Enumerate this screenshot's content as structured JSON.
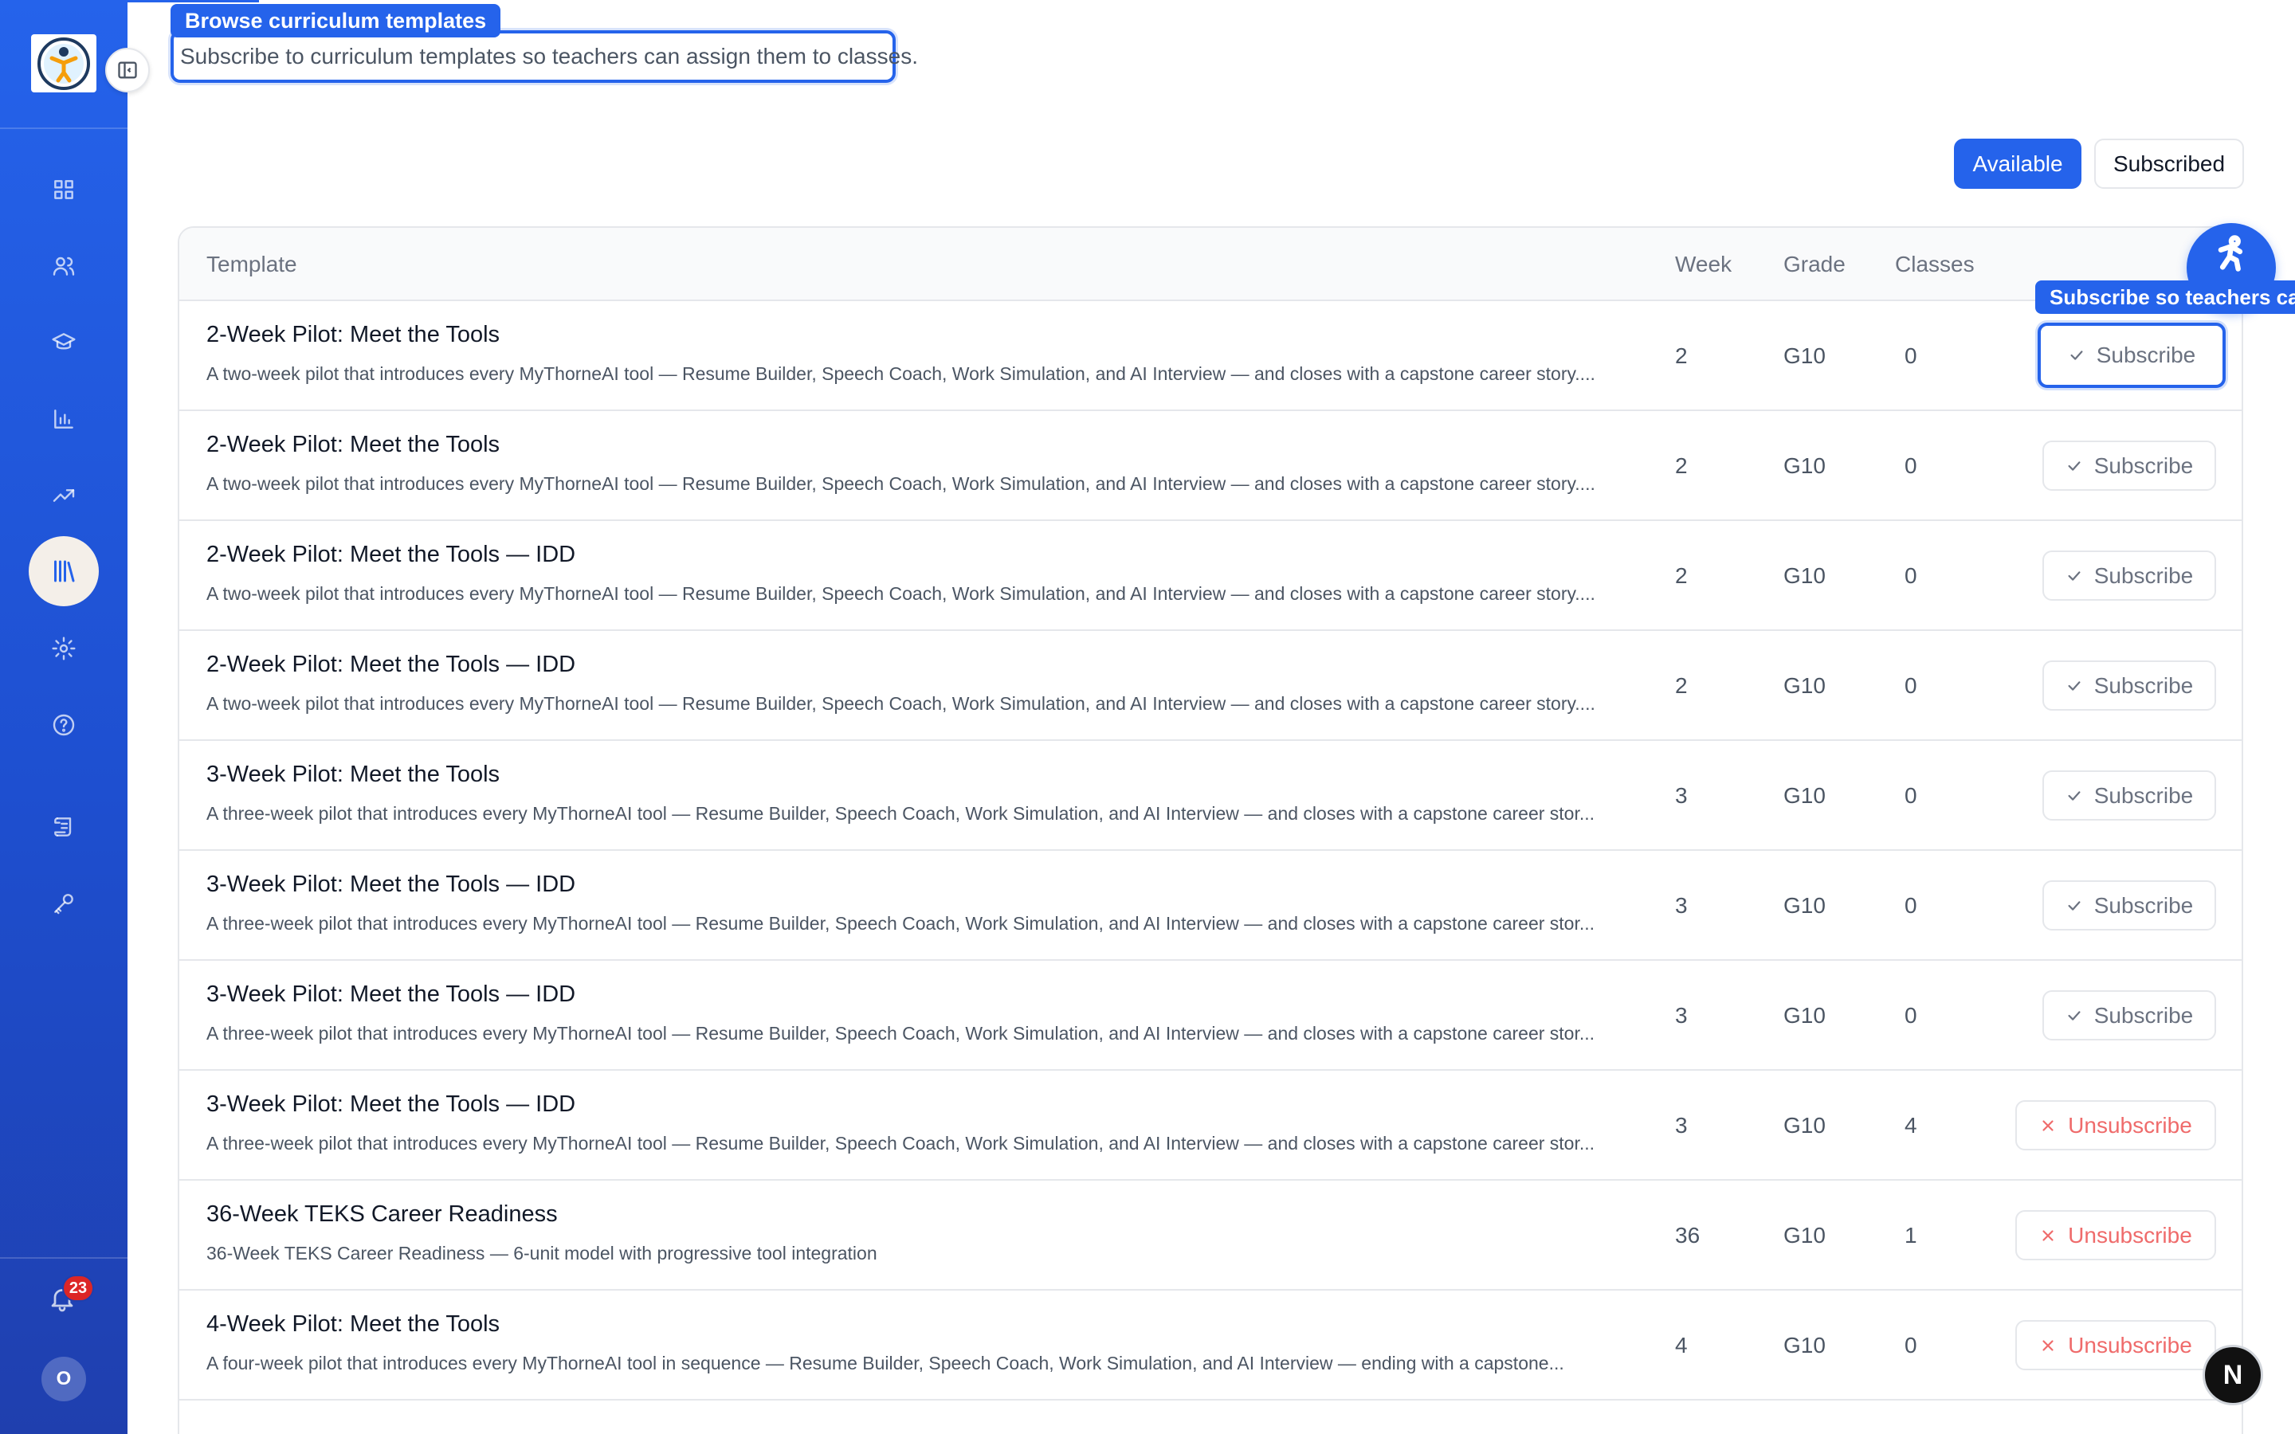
{
  "header": {
    "tour_badge": "Browse curriculum templates",
    "subtitle": "Subscribe to curriculum templates so teachers can assign them to classes."
  },
  "toggle": {
    "available_label": "Available",
    "subscribed_label": "Subscribed"
  },
  "table": {
    "columns": {
      "template": "Template",
      "week": "Week",
      "grade": "Grade",
      "classes": "Classes"
    },
    "rows": [
      {
        "title": "2-Week Pilot: Meet the Tools",
        "description": "A two-week pilot that introduces every MyThorneAI tool — Resume Builder, Speech Coach, Work Simulation, and AI Interview — and closes with a capstone career story....",
        "week": "2",
        "grade": "G10",
        "classes": "0",
        "action": "Subscribe"
      },
      {
        "title": "2-Week Pilot: Meet the Tools",
        "description": "A two-week pilot that introduces every MyThorneAI tool — Resume Builder, Speech Coach, Work Simulation, and AI Interview — and closes with a capstone career story....",
        "week": "2",
        "grade": "G10",
        "classes": "0",
        "action": "Subscribe"
      },
      {
        "title": "2-Week Pilot: Meet the Tools — IDD",
        "description": "A two-week pilot that introduces every MyThorneAI tool — Resume Builder, Speech Coach, Work Simulation, and AI Interview — and closes with a capstone career story....",
        "week": "2",
        "grade": "G10",
        "classes": "0",
        "action": "Subscribe"
      },
      {
        "title": "2-Week Pilot: Meet the Tools — IDD",
        "description": "A two-week pilot that introduces every MyThorneAI tool — Resume Builder, Speech Coach, Work Simulation, and AI Interview — and closes with a capstone career story....",
        "week": "2",
        "grade": "G10",
        "classes": "0",
        "action": "Subscribe"
      },
      {
        "title": "3-Week Pilot: Meet the Tools",
        "description": "A three-week pilot that introduces every MyThorneAI tool — Resume Builder, Speech Coach, Work Simulation, and AI Interview — and closes with a capstone career stor...",
        "week": "3",
        "grade": "G10",
        "classes": "0",
        "action": "Subscribe"
      },
      {
        "title": "3-Week Pilot: Meet the Tools — IDD",
        "description": "A three-week pilot that introduces every MyThorneAI tool — Resume Builder, Speech Coach, Work Simulation, and AI Interview — and closes with a capstone career stor...",
        "week": "3",
        "grade": "G10",
        "classes": "0",
        "action": "Subscribe"
      },
      {
        "title": "3-Week Pilot: Meet the Tools — IDD",
        "description": "A three-week pilot that introduces every MyThorneAI tool — Resume Builder, Speech Coach, Work Simulation, and AI Interview — and closes with a capstone career stor...",
        "week": "3",
        "grade": "G10",
        "classes": "0",
        "action": "Subscribe"
      },
      {
        "title": "3-Week Pilot: Meet the Tools — IDD",
        "description": "A three-week pilot that introduces every MyThorneAI tool — Resume Builder, Speech Coach, Work Simulation, and AI Interview — and closes with a capstone career stor...",
        "week": "3",
        "grade": "G10",
        "classes": "4",
        "action": "Unsubscribe"
      },
      {
        "title": "36-Week TEKS Career Readiness",
        "description": "36-Week TEKS Career Readiness — 6-unit model with progressive tool integration",
        "week": "36",
        "grade": "G10",
        "classes": "1",
        "action": "Unsubscribe"
      },
      {
        "title": "4-Week Pilot: Meet the Tools",
        "description": "A four-week pilot that introduces every MyThorneAI tool in sequence — Resume Builder, Speech Coach, Work Simulation, and AI Interview — ending with a capstone...",
        "week": "4",
        "grade": "G10",
        "classes": "0",
        "action": "Unsubscribe"
      }
    ]
  },
  "tour_tip": "Subscribe so teachers ca",
  "notifications": {
    "count": "23"
  },
  "user": {
    "initial": "O"
  },
  "floating": {
    "n_label": "N"
  },
  "sidebar": {
    "icons": [
      "dashboard-icon",
      "users-icon",
      "graduation-cap-icon",
      "bar-chart-icon",
      "trending-up-icon",
      "library-icon",
      "settings-icon",
      "help-icon",
      "scroll-icon",
      "key-icon"
    ],
    "active": "library-icon"
  },
  "colors": {
    "accent": "#2563eb",
    "danger": "#ef6b6b",
    "badge": "#dc2626"
  }
}
